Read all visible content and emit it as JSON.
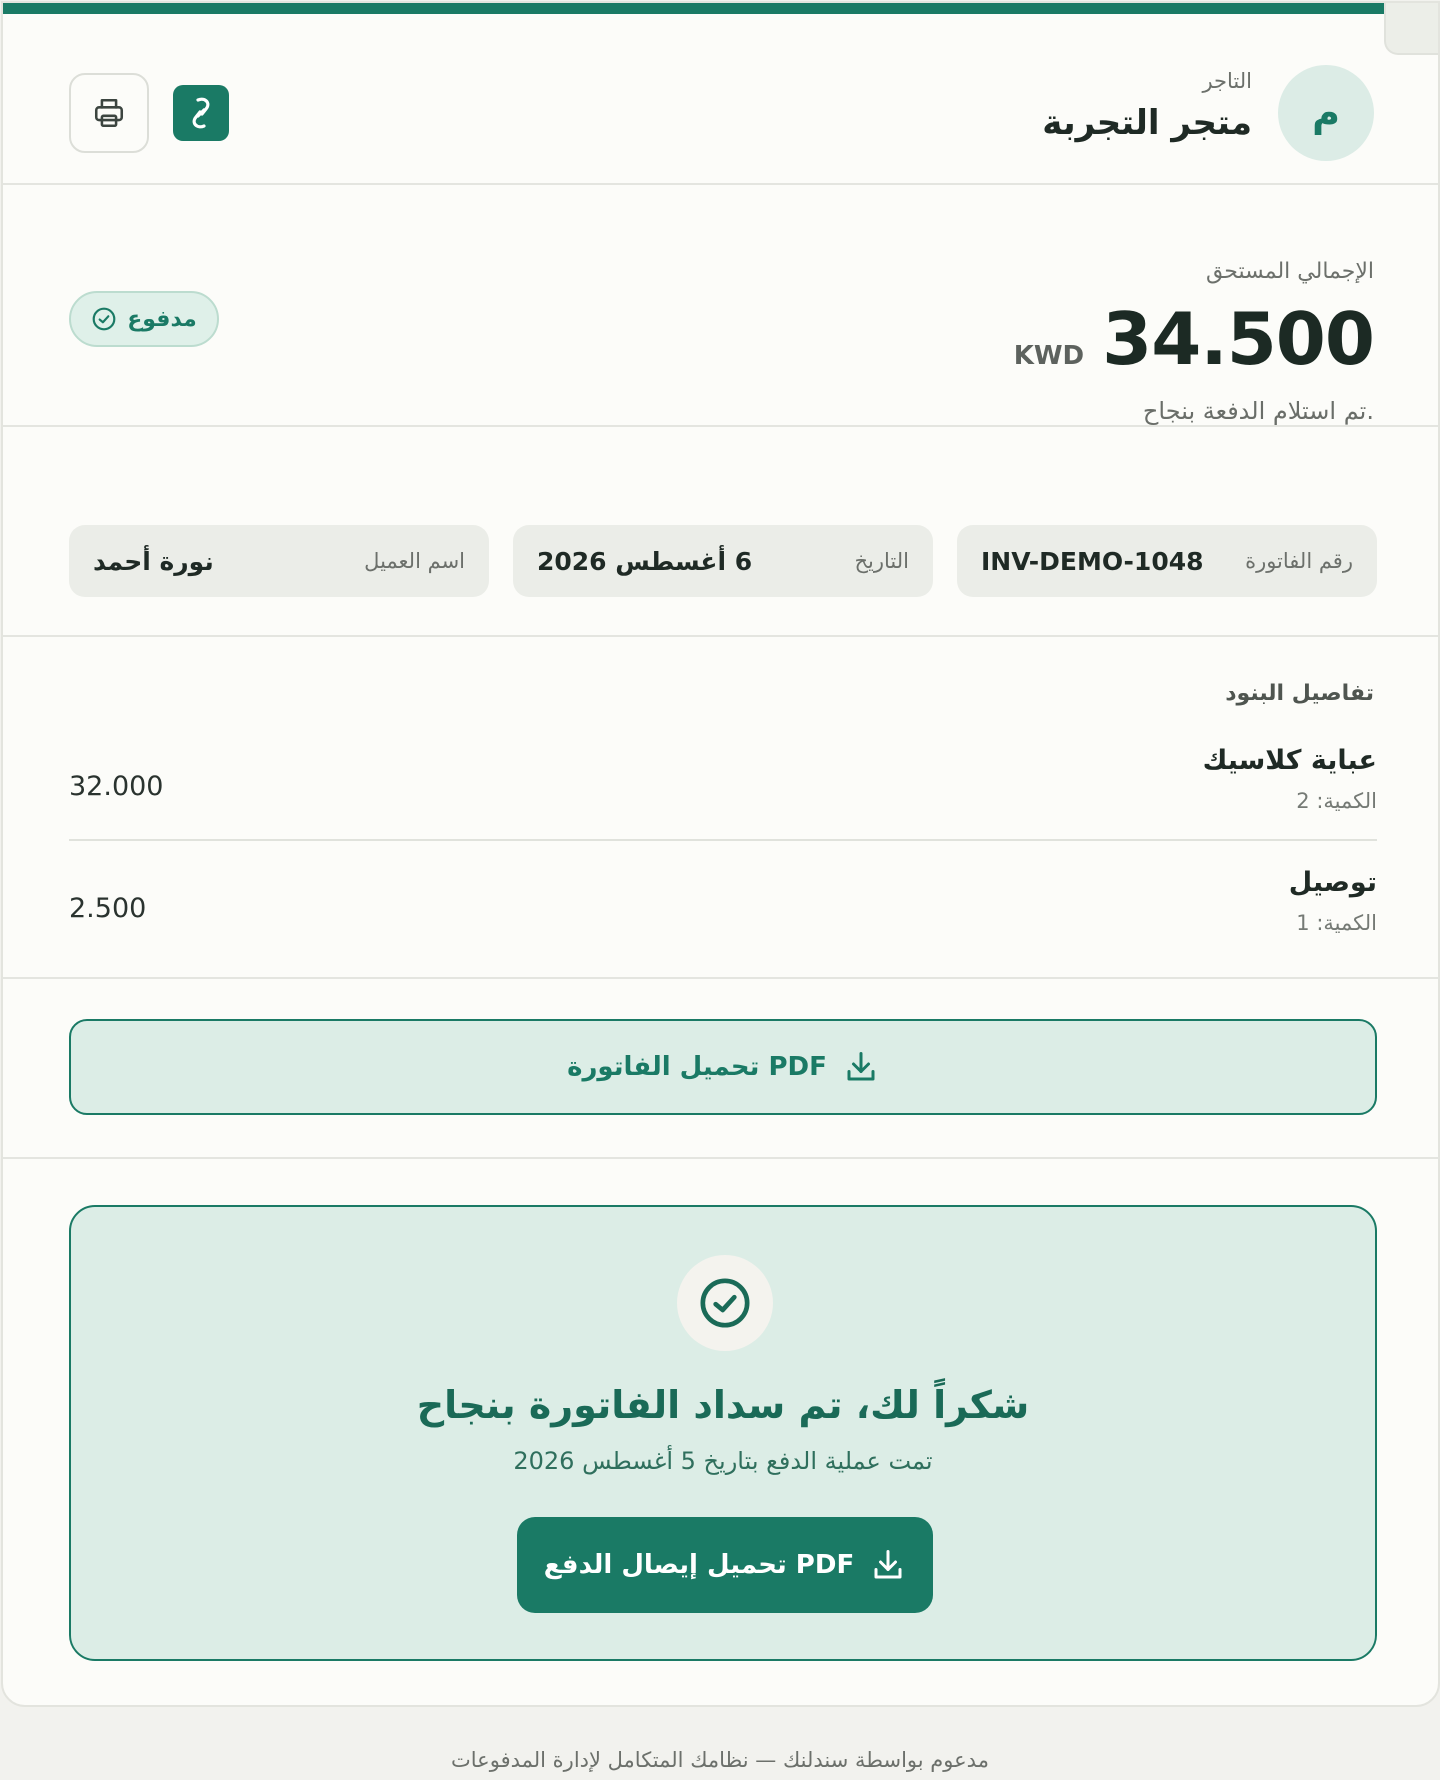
{
  "merchant": {
    "avatar_letter": "م",
    "label": "التاجر",
    "name": "متجر التجربة"
  },
  "header": {
    "link_icon": "link-icon",
    "print_icon": "printer-icon"
  },
  "total": {
    "label": "الإجمالي المستحق",
    "amount": "34.500",
    "currency": "KWD",
    "note": "تم استلام الدفعة بنجاح."
  },
  "status": {
    "label": "مدفوع",
    "icon": "check-circle-icon"
  },
  "info": {
    "invoice_label": "رقم الفاتورة",
    "invoice_value": "INV-DEMO-1048",
    "date_label": "التاريخ",
    "date_value": "6 أغسطس 2026",
    "customer_label": "اسم العميل",
    "customer_value": "نورة أحمد"
  },
  "items": {
    "title": "تفاصيل البنود",
    "list": [
      {
        "name": "عباية كلاسيك",
        "qty": "الكمية: 2",
        "price": "32.000"
      },
      {
        "name": "توصيل",
        "qty": "الكمية: 1",
        "price": "2.500"
      }
    ]
  },
  "download": {
    "label": "تحميل الفاتورة PDF",
    "icon": "download-icon"
  },
  "success": {
    "title": "شكراً لك، تم سداد الفاتورة بنجاح",
    "subtitle": "تمت عملية الدفع بتاريخ 5 أغسطس 2026",
    "receipt_button": "تحميل إيصال الدفع PDF"
  },
  "footer": "مدعوم بواسطة سندلنك — نظامك المتكامل لإدارة المدفوعات",
  "colors": {
    "accent": "#1a7a65",
    "accent_light": "#dcede6",
    "background": "#fcfcf9"
  }
}
